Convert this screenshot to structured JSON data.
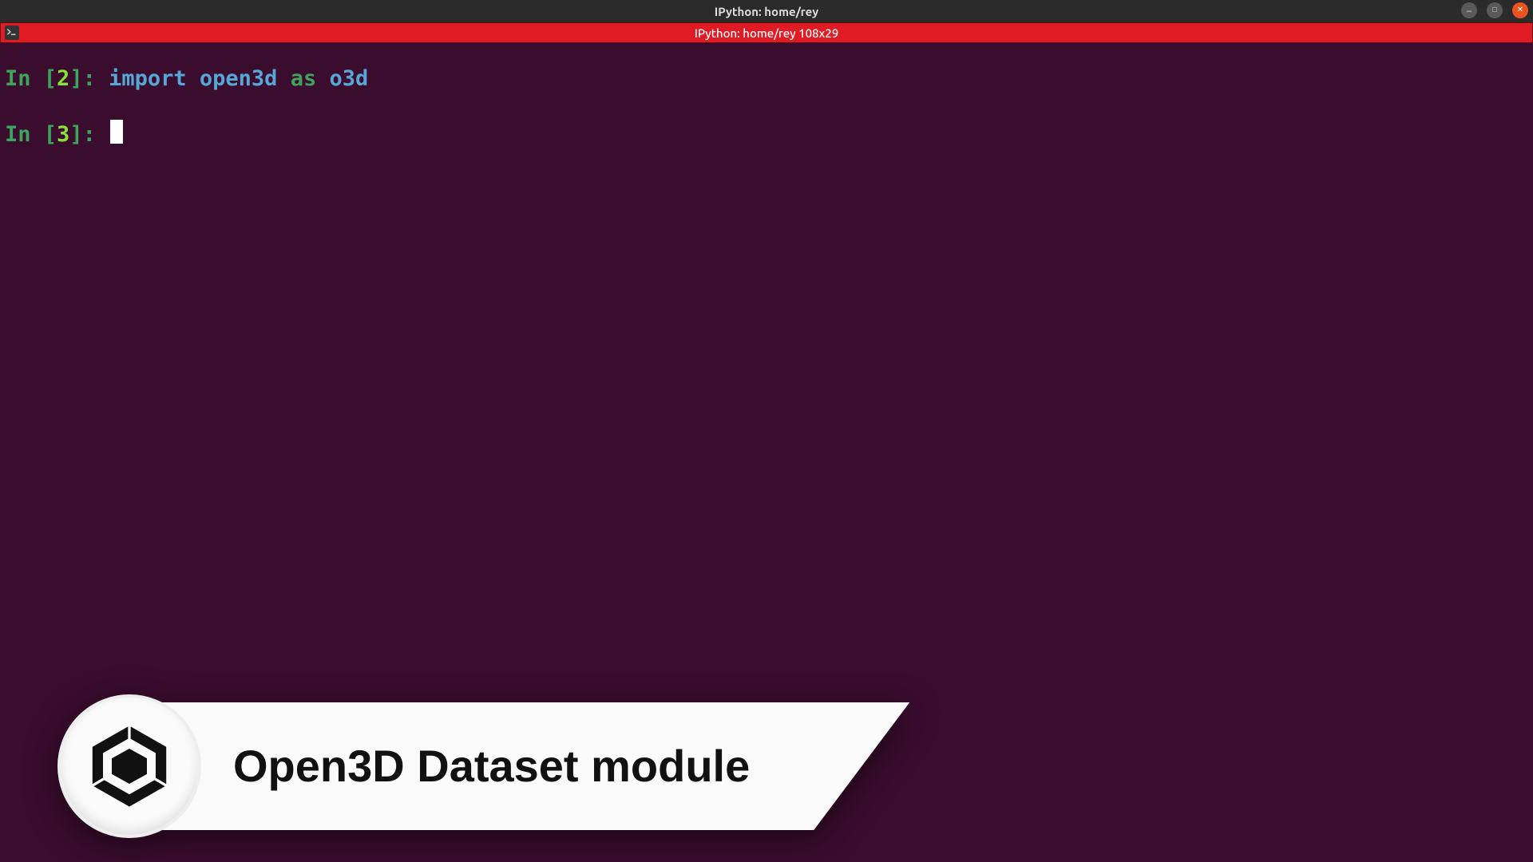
{
  "window": {
    "title": "IPython: home/rey",
    "status": "IPython: home/rey 108x29"
  },
  "terminal": {
    "lines": [
      {
        "prompt_in": "In ",
        "prompt_open": "[",
        "prompt_num": "2",
        "prompt_close": "]: ",
        "code": {
          "import": "import",
          "sp1": " ",
          "module": "open3d",
          "sp2": " ",
          "as": "as",
          "sp3": " ",
          "alias": "o3d"
        }
      },
      {
        "prompt_in": "In ",
        "prompt_open": "[",
        "prompt_num": "3",
        "prompt_close": "]: ",
        "cursor": true
      }
    ]
  },
  "overlay": {
    "logo_name": "open3d-hex-logo",
    "title": "Open3D Dataset module"
  },
  "colors": {
    "terminal_bg": "#3a0c2e",
    "status_bg": "#e01b24",
    "prompt_green": "#3da35d",
    "prompt_bright": "#8ae234",
    "keyword_blue": "#57a7d6"
  }
}
